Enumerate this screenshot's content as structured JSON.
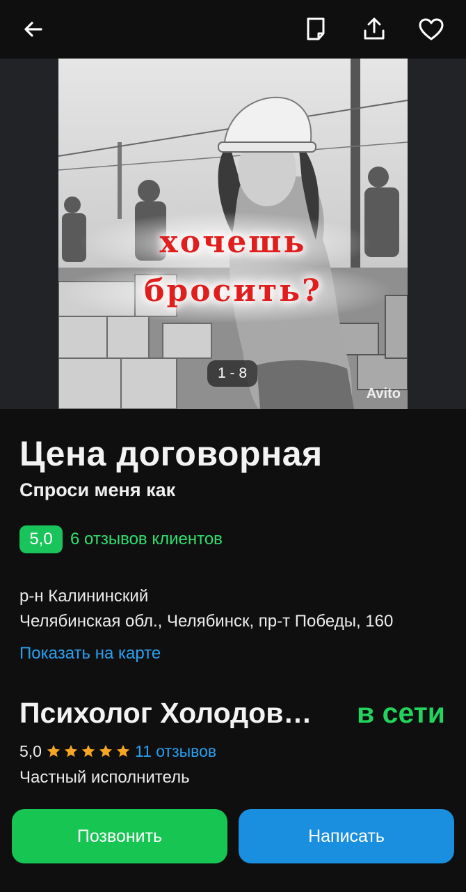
{
  "topbar": {
    "icons": [
      "back-arrow-icon",
      "note-icon",
      "share-icon",
      "heart-icon"
    ]
  },
  "gallery": {
    "overlay_line1": "хочешь",
    "overlay_line2": "бросить?",
    "counter": "1 - 8",
    "watermark": "Avito"
  },
  "listing": {
    "price": "Цена договорная",
    "title": "Спроси меня как",
    "rating": "5,0",
    "reviews": "6 отзывов клиентов",
    "district": "р-н Калининский",
    "address": "Челябинская обл., Челябинск, пр-т Победы, 160",
    "map_link": "Показать на карте"
  },
  "seller": {
    "name": "Психолог Холодов…",
    "status": "в сети",
    "rating": "5,0",
    "stars": 5,
    "reviews": "11 отзывов",
    "type": "Частный исполнитель"
  },
  "actions": {
    "call": "Позвонить",
    "write": "Написать"
  },
  "colors": {
    "accent_green": "#19c45a",
    "accent_blue": "#1a8fe0",
    "link_blue": "#2aa0f0",
    "star": "#f5a623"
  }
}
